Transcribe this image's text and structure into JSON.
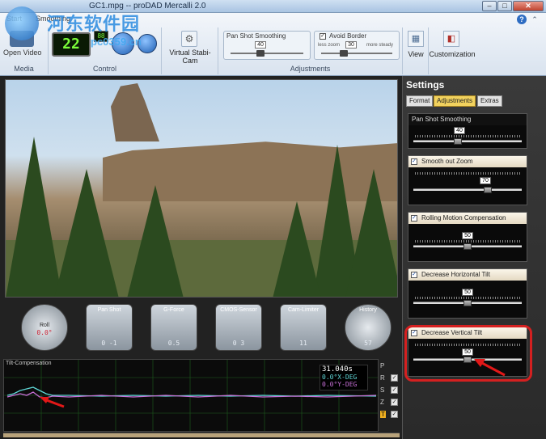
{
  "window": {
    "title": "GC1.mpg -- proDAD Mercalli 2.0",
    "min": "–",
    "max": "□",
    "close": "✕"
  },
  "ribbon": {
    "tabs": [
      "Start",
      "Smoothing"
    ],
    "help_icon": "?",
    "media": {
      "open_label": "Open Video",
      "group_label": "Media"
    },
    "control": {
      "lcd": "22",
      "lcd_sub": "88",
      "group_label": "Control"
    },
    "vsc": {
      "label": "Virtual Stabi-Cam",
      "icon": "gear-icon"
    },
    "adjustments": {
      "group_label": "Adjustments",
      "pan_label": "Pan Shot Smoothing",
      "pan_value": "40",
      "pan_pct": 0.4,
      "border_label": "Avoid Border",
      "border_checked": "✓",
      "border_value": "30",
      "border_pct": 0.3,
      "less_zoom": "less zoom",
      "more_steady": "more steady"
    },
    "view": {
      "label": "View"
    },
    "customization": {
      "label": "Customization"
    }
  },
  "watermark": {
    "text": "河东软件园",
    "url": "pc0359.cn"
  },
  "meters": [
    {
      "title": "Roll",
      "value": "0.0°"
    },
    {
      "title": "Pan Shot",
      "value": "0  -1"
    },
    {
      "title": "G-Force",
      "value": "0.5"
    },
    {
      "title": "CMOS-Sensor",
      "value": "0   3"
    },
    {
      "title": "Cam-Limiter",
      "value": "11"
    },
    {
      "title": "History",
      "value": "57"
    }
  ],
  "graph": {
    "title": "Tilt-Compensation",
    "time": "31.040s",
    "x_deg": "0.0°X-DEG",
    "y_deg": "0.0°Y-DEG",
    "axes": [
      {
        "letter": "P",
        "checked": ""
      },
      {
        "letter": "R",
        "checked": "✓"
      },
      {
        "letter": "S",
        "checked": "✓"
      },
      {
        "letter": "Z",
        "checked": "✓"
      },
      {
        "letter": "T",
        "checked": "✓"
      }
    ],
    "colors": {
      "cyan": "#5fd6d6",
      "magenta": "#c870d8",
      "grid": "#1e5e1e"
    }
  },
  "settings": {
    "title": "Settings",
    "tabs": [
      "Format",
      "Adjustments",
      "Extras"
    ],
    "active_tab": "Adjustments",
    "panels": [
      {
        "label": "Pan Shot Smoothing",
        "checkable": false,
        "value": "40",
        "pct": 0.4
      },
      {
        "label": "Smooth out Zoom",
        "checkable": true,
        "checked": "✓",
        "value": "70",
        "pct": 0.7
      },
      {
        "label": "Rolling Motion Compensation",
        "checkable": true,
        "checked": "✓",
        "value": "50",
        "pct": 0.5
      },
      {
        "label": "Decrease Horizontal Tilt",
        "checkable": true,
        "checked": "✓",
        "value": "50",
        "pct": 0.5
      },
      {
        "label": "Decrease Vertical Tilt",
        "checkable": true,
        "checked": "✓",
        "value": "50",
        "pct": 0.5
      }
    ]
  },
  "colors": {
    "accent": "#f2d25e",
    "highlight": "#d52020",
    "lcd": "#7cff3a"
  }
}
